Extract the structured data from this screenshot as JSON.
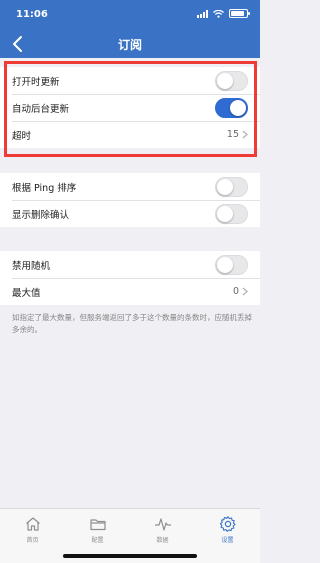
{
  "status_bar": {
    "time": "11:06"
  },
  "nav": {
    "title": "订阅",
    "back_icon": "chevron-left-icon"
  },
  "section1": {
    "items": [
      {
        "label": "打开时更新",
        "type": "toggle",
        "on": false
      },
      {
        "label": "自动后台更新",
        "type": "toggle",
        "on": true
      },
      {
        "label": "超时",
        "type": "value",
        "value": "15"
      }
    ]
  },
  "section2": {
    "items": [
      {
        "label": "根据 Ping 排序",
        "type": "toggle",
        "on": false
      },
      {
        "label": "显示删除确认",
        "type": "toggle",
        "on": false
      }
    ]
  },
  "section3": {
    "items": [
      {
        "label": "禁用随机",
        "type": "toggle",
        "on": false
      },
      {
        "label": "最大值",
        "type": "value",
        "value": "0"
      }
    ],
    "footnote": "如指定了最大数量，但服务端返回了多于这个数量的条数时，应随机丢掉多余的。"
  },
  "tabbar": {
    "items": [
      {
        "label": "首页",
        "icon": "home-icon",
        "active": false
      },
      {
        "label": "配置",
        "icon": "folder-icon",
        "active": false
      },
      {
        "label": "数据",
        "icon": "pulse-icon",
        "active": false
      },
      {
        "label": "设置",
        "icon": "gear-icon",
        "active": true
      }
    ]
  },
  "colors": {
    "accent": "#3a73c6",
    "highlight_box": "#ee3b35",
    "toggle_on": "#2f6bd2"
  }
}
